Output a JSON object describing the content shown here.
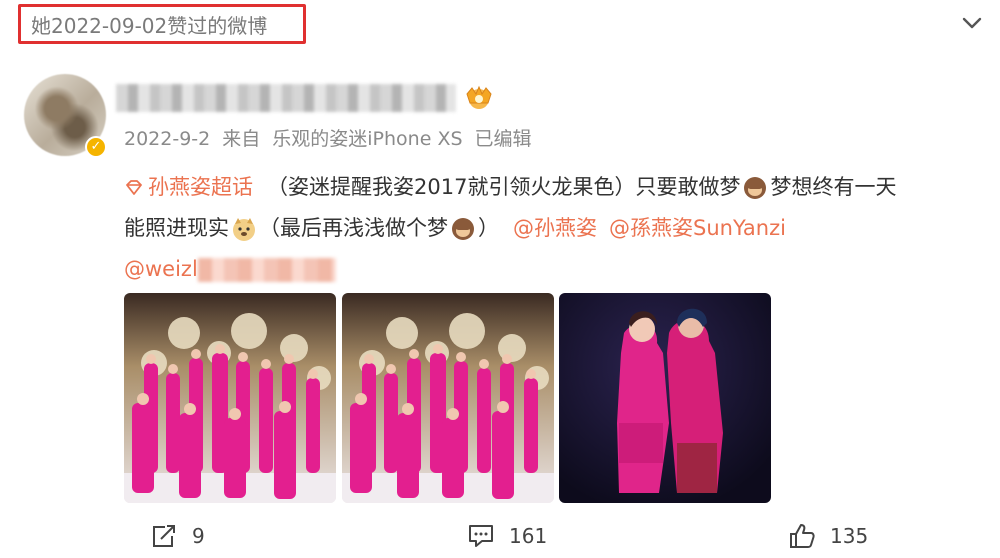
{
  "header": {
    "liked_label": "她2022-09-02赞过的微博"
  },
  "post": {
    "meta": {
      "date": "2022-9-2",
      "from_label": "来自",
      "source": "乐观的姿迷iPhone XS",
      "edited": "已编辑"
    },
    "content": {
      "topic": "孙燕姿超话",
      "text1": "（姿迷提醒我姿2017就引领火龙果色）只要敢做梦",
      "text2": "梦想终有一天",
      "text3": "能照进现实",
      "text4": "（最后再浅浅做个梦",
      "text5": "）",
      "mention1": "@孙燕姿",
      "mention2": "@孫燕姿SunYanzi",
      "mention3_prefix": "@weizl"
    },
    "actions": {
      "share_count": "9",
      "comment_count": "161",
      "like_count": "135"
    }
  },
  "icons": [
    "chevron-down-icon",
    "verified-badge-icon",
    "crown-badge-icon",
    "topic-diamond-icon",
    "monkey-emoji-icon",
    "doge-emoji-icon",
    "share-icon",
    "comment-icon",
    "like-icon"
  ],
  "colors": {
    "accent_link": "#eb7350",
    "highlight_box": "#e03030",
    "meta_gray": "#8a8a8a",
    "verified": "#f5b400"
  }
}
